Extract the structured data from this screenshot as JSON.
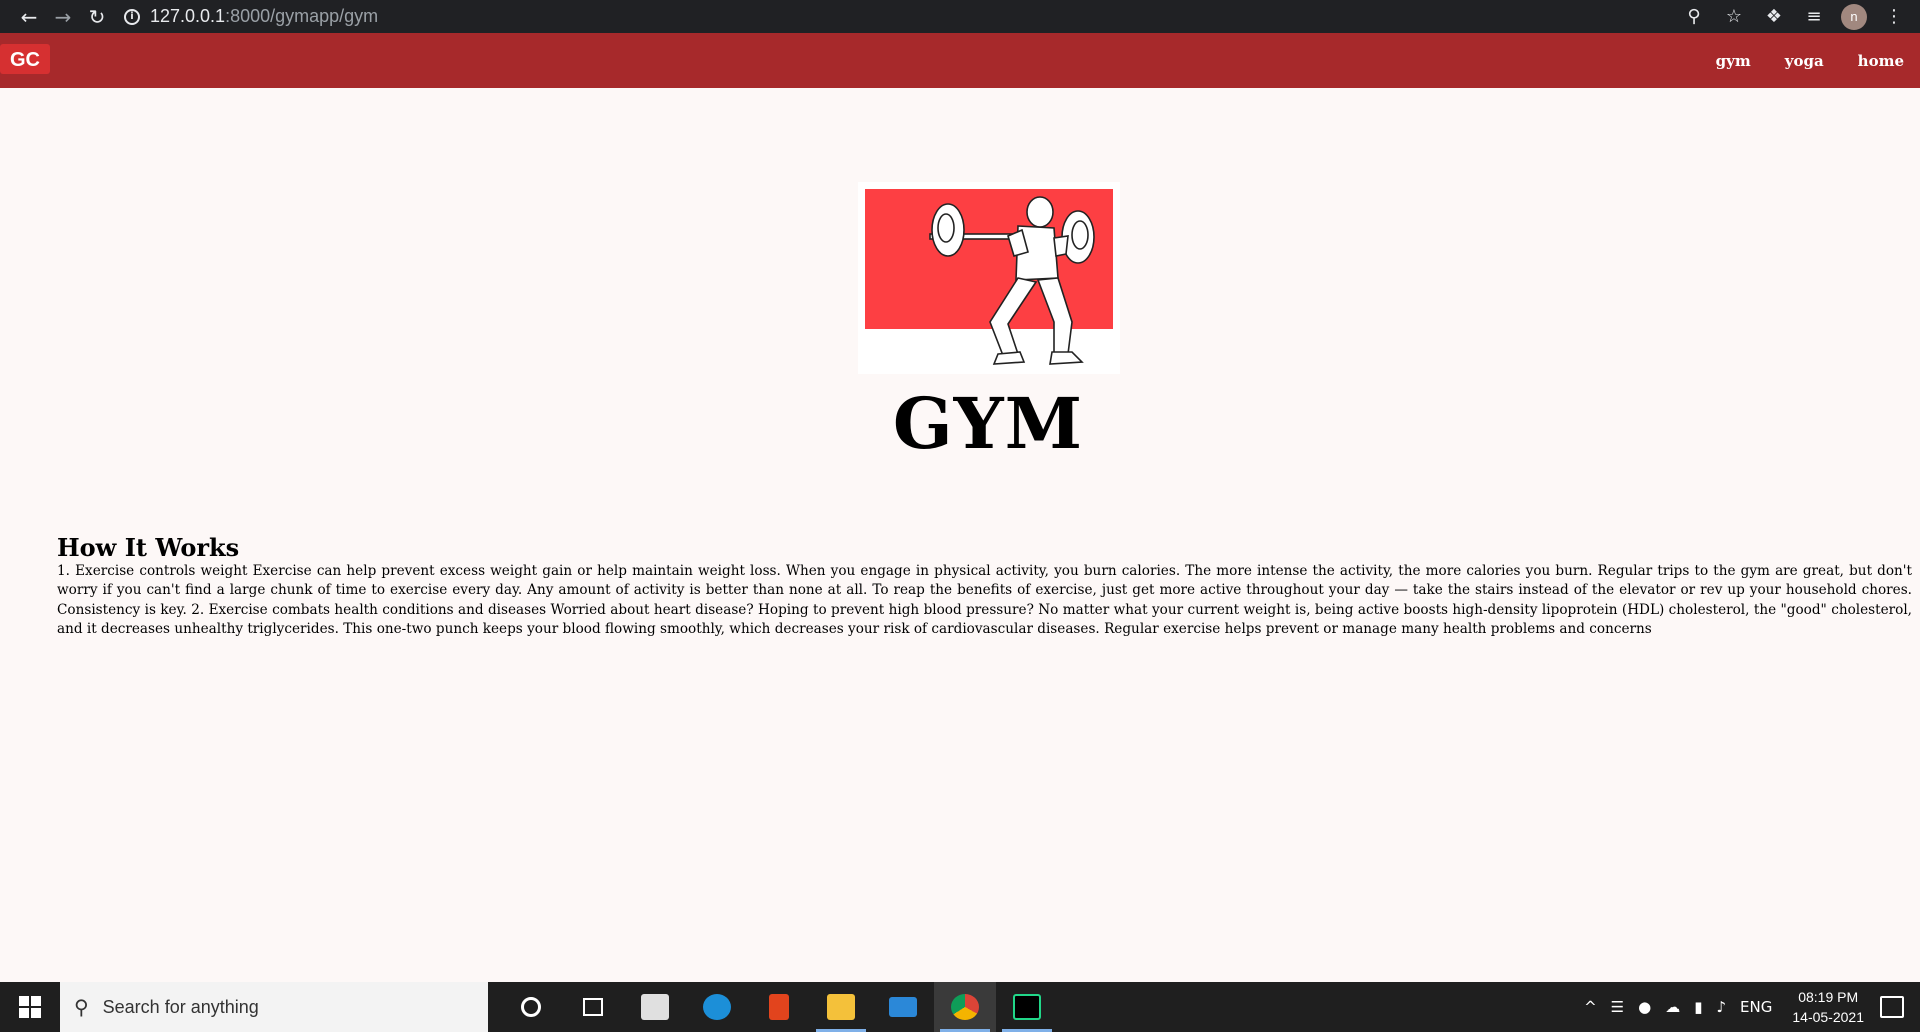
{
  "browser": {
    "url_host": "127.0.0.1",
    "url_rest": ":8000/gymapp/gym"
  },
  "navbar": {
    "links": [
      "gym",
      "yoga",
      "home"
    ]
  },
  "hero": {
    "title": "GYM"
  },
  "how_it_works": {
    "title": "How It Works",
    "body": "1. Exercise controls weight Exercise can help prevent excess weight gain or help maintain weight loss. When you engage in physical activity, you burn calories. The more intense the activity, the more calories you burn. Regular trips to the gym are great, but don't worry if you can't find a large chunk of time to exercise every day. Any amount of activity is better than none at all. To reap the benefits of exercise, just get more active throughout your day — take the stairs instead of the elevator or rev up your household chores. Consistency is key. 2. Exercise combats health conditions and diseases Worried about heart disease? Hoping to prevent high blood pressure? No matter what your current weight is, being active boosts high-density lipoprotein (HDL) cholesterol, the \"good\" cholesterol, and it decreases unhealthy triglycerides. This one-two punch keeps your blood flowing smoothly, which decreases your risk of cardiovascular diseases. Regular exercise helps prevent or manage many health problems and concerns"
  },
  "taskbar": {
    "search_placeholder": "Search for anything",
    "language": "ENG",
    "time": "08:19 PM",
    "date": "14-05-2021"
  },
  "avatar_letter": "n",
  "colors": {
    "navbar": "#a7292b",
    "hero_red": "#fd3f43",
    "page_bg": "#fdf8f7"
  }
}
